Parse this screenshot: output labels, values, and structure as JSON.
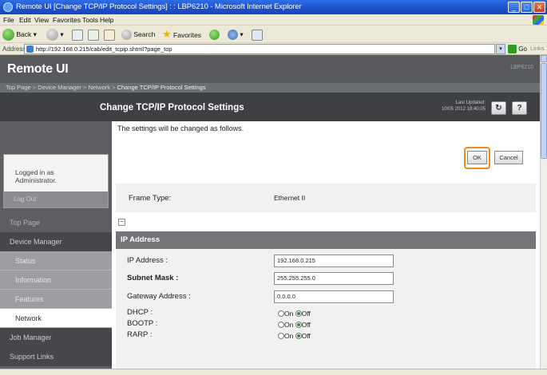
{
  "window": {
    "title": "Remote UI [Change TCP/IP Protocol Settings] : : LBP6210 - Microsoft Internet Explorer",
    "minimize": "_",
    "maximize": "□",
    "close": "✕"
  },
  "menu": [
    "File",
    "Edit",
    "View",
    "Favorites",
    "Tools",
    "Help"
  ],
  "toolbar": {
    "back": "Back",
    "search": "Search",
    "favorites": "Favorites"
  },
  "addressbar": {
    "label": "Address",
    "url": "http://192.168.0.215/cab/edit_tcpip.shtml?page_top",
    "go": "Go",
    "links": "Links"
  },
  "remoteui": {
    "logo": "Remote UI",
    "model": "LBP6210",
    "breadcrumb": [
      {
        "label": "Top Page"
      },
      {
        "label": "Device Manager"
      },
      {
        "label": "Network"
      },
      {
        "label": "Change TCP/IP Protocol Settings"
      }
    ],
    "breadcrumb_sep": ">",
    "page_title": "Change TCP/IP Protocol Settings",
    "last_updated_label": "Last Updated:",
    "last_updated_value": "10/05 2012 18:40:05",
    "refresh_icon": "↻",
    "help_label": "?"
  },
  "sidebar": {
    "login_text": "Logged in as Administrator.",
    "logout": "Log Out",
    "items": [
      {
        "label": "Top Page"
      },
      {
        "label": "Device Manager"
      },
      {
        "label": "Status"
      },
      {
        "label": "Information"
      },
      {
        "label": "Features"
      },
      {
        "label": "Network"
      },
      {
        "label": "Job Manager"
      },
      {
        "label": "Support Links"
      }
    ]
  },
  "content": {
    "notice": "The settings will be changed as follows.",
    "ok_label": "OK",
    "cancel_label": "Cancel",
    "frame_type_label": "Frame Type:",
    "frame_type_value": "Ethernet II",
    "collapse_icon": "−",
    "ip_section_title": "IP Address",
    "fields": [
      {
        "label": "IP Address :",
        "value": "192.168.0.215"
      },
      {
        "label": "Subnet Mask :",
        "value": "255.255.255.0"
      },
      {
        "label": "Gateway Address :",
        "value": "0.0.0.0"
      }
    ],
    "protocols": [
      {
        "label": "DHCP :",
        "on": "On",
        "off": "Off",
        "selected": "Off"
      },
      {
        "label": "BOOTP :",
        "on": "On",
        "off": "Off",
        "selected": "Off"
      },
      {
        "label": "RARP :",
        "on": "On",
        "off": "Off",
        "selected": "Off"
      }
    ]
  },
  "colors": {
    "header_bg": "#57595c",
    "title_bar_bg": "#3e4043",
    "sidebar_bg": "#5c5e62",
    "ok_highlight": "#f08a1a"
  }
}
